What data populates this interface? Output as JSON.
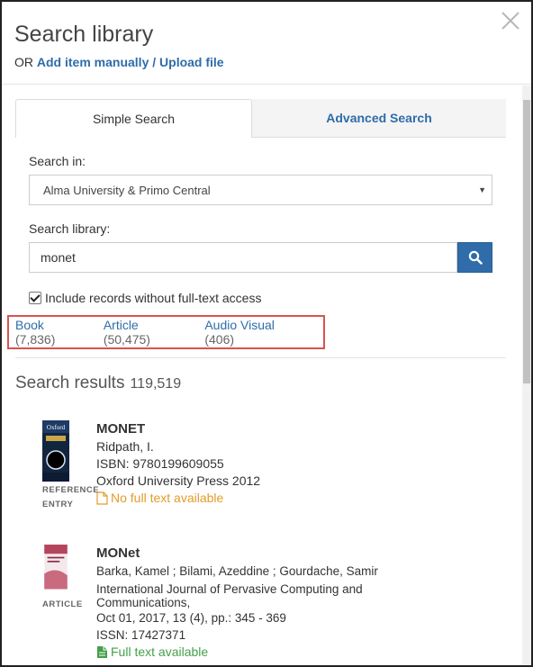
{
  "header": {
    "title": "Search library",
    "or_text": "OR",
    "add_manual_label": "Add item manually",
    "separator": "/",
    "upload_label": "Upload file"
  },
  "tabs": {
    "simple": "Simple Search",
    "advanced": "Advanced Search"
  },
  "form": {
    "search_in_label": "Search in:",
    "search_in_value": "Alma University & Primo Central",
    "search_library_label": "Search library:",
    "search_value": "monet",
    "include_label": "Include records without full-text access",
    "include_checked": true
  },
  "facets": [
    {
      "name": "Book",
      "count": "(7,836)"
    },
    {
      "name": "Article",
      "count": "(50,475)"
    },
    {
      "name": "Audio Visual",
      "count": "(406)"
    }
  ],
  "results": {
    "label": "Search results",
    "count": "119,519",
    "items": [
      {
        "type_line1": "REFERENCE",
        "type_line2": "ENTRY",
        "title": "MONET",
        "author": "Ridpath, I.",
        "isbn": "ISBN: 9780199609055",
        "publisher": "Oxford University Press 2012",
        "availability": "No full text available",
        "thumb_text": "Oxford"
      },
      {
        "type_line1": "ARTICLE",
        "title": "MONet",
        "author": "Barka, Kamel ; Bilami, Azeddine ; Gourdache, Samir",
        "journal": "International Journal of Pervasive Computing and Communications,",
        "date": "Oct 01, 2017,  13 (4),  pp.: 345 - 369",
        "issn": "ISSN: 17427371",
        "availability": "Full text available"
      }
    ]
  },
  "colors": {
    "link": "#2f6ca9",
    "highlight_border": "#d9534f",
    "no_fulltext": "#e39b2a",
    "fulltext": "#45a04a"
  }
}
